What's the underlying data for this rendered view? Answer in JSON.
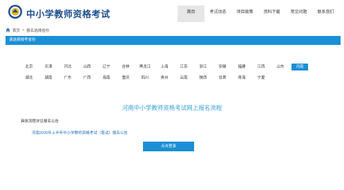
{
  "header": {
    "site_title": "中小学教师资格考试",
    "nav": [
      "首页",
      "考试动态",
      "项目政策",
      "资料下载",
      "常见问题",
      "联系我们"
    ],
    "active_nav_index": 0
  },
  "breadcrumb": {
    "home": "首页",
    "separator": ">",
    "current": "报名选择省份"
  },
  "banner": {
    "text": "请选择报考省份"
  },
  "provinces": {
    "items": [
      "北京",
      "天津",
      "河北",
      "山西",
      "辽宁",
      "吉林",
      "黑龙江",
      "上海",
      "江苏",
      "浙江",
      "安徽",
      "福建",
      "江西",
      "山东",
      "河南",
      "湖北",
      "湖南",
      "广东",
      "广西",
      "海南",
      "重庆",
      "四川",
      "贵州",
      "云南",
      "陕西",
      "甘肃",
      "青海",
      "宁夏"
    ],
    "selected": "河南"
  },
  "process": {
    "title": "河南中小学教师资格考试网上报名流程",
    "detail_label": "具体流程详见报名公告",
    "announcement": "河南2020年上半年中小学教师资格考试（笔试）报名公告",
    "login_button": "点击登录"
  },
  "colors": {
    "accent": "#1a8fd5",
    "title_blue": "#1d4e8f",
    "process_title": "#3ba1dc",
    "link": "#1a6fb8"
  }
}
